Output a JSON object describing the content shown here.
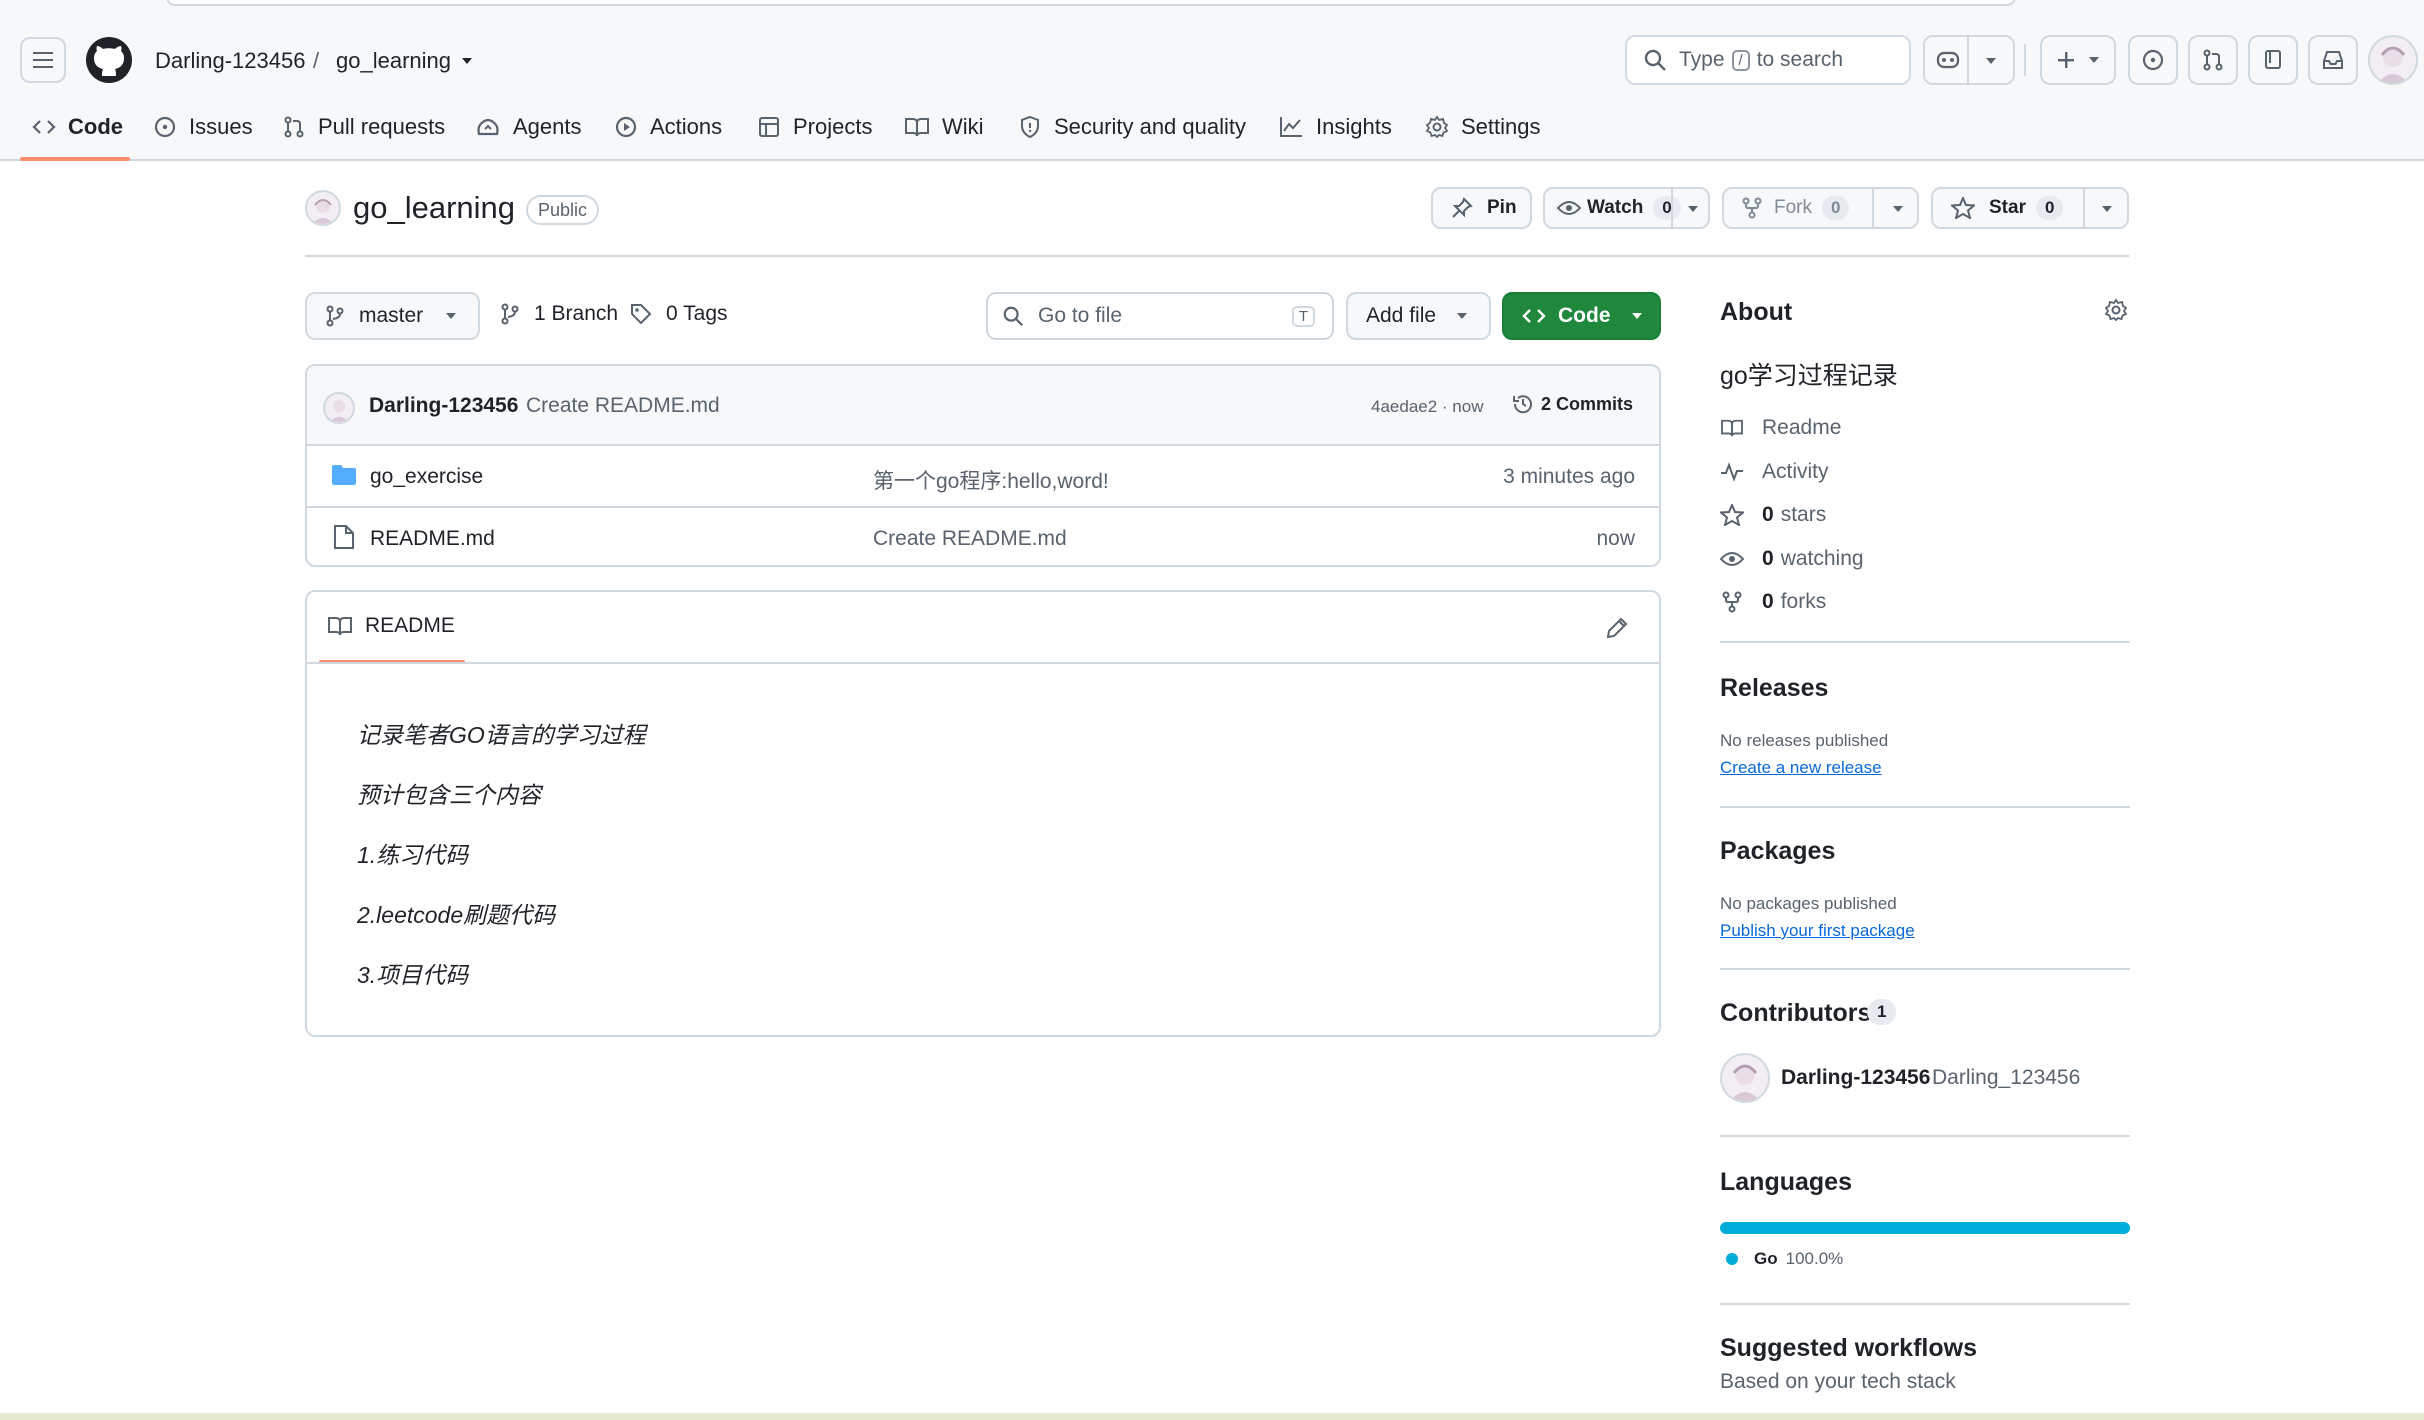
{
  "header": {
    "owner": "Darling-123456",
    "separator": "/",
    "repo": "go_learning",
    "search": {
      "prefix": "Type",
      "key": "/",
      "suffix": "to search"
    }
  },
  "nav": {
    "tabs": [
      {
        "label": "Code",
        "icon": "code-icon"
      },
      {
        "label": "Issues",
        "icon": "issue-opened-icon"
      },
      {
        "label": "Pull requests",
        "icon": "git-pull-request-icon"
      },
      {
        "label": "Agents",
        "icon": "agent-icon"
      },
      {
        "label": "Actions",
        "icon": "play-icon"
      },
      {
        "label": "Projects",
        "icon": "table-icon"
      },
      {
        "label": "Wiki",
        "icon": "book-icon"
      },
      {
        "label": "Security and quality",
        "icon": "shield-icon"
      },
      {
        "label": "Insights",
        "icon": "graph-icon"
      },
      {
        "label": "Settings",
        "icon": "gear-icon"
      }
    ],
    "active": "Code"
  },
  "repo": {
    "name": "go_learning",
    "visibility": "Public",
    "pin_label": "Pin",
    "watch_label": "Watch",
    "watch_count": "0",
    "fork_label": "Fork",
    "fork_count": "0",
    "star_label": "Star",
    "star_count": "0"
  },
  "toolbar": {
    "branch": "master",
    "branches": "1 Branch",
    "tags": "0 Tags",
    "go_to_file_placeholder": "Go to file",
    "go_to_file_key": "T",
    "add_file": "Add file",
    "code": "Code"
  },
  "latest_commit": {
    "author": "Darling-123456",
    "message": "Create README.md",
    "hash_time": "4aedae2 · now",
    "commits": "2 Commits"
  },
  "files": [
    {
      "name": "go_exercise",
      "type": "folder",
      "message": "第一个go程序:hello,word!",
      "time": "3 minutes ago"
    },
    {
      "name": "README.md",
      "type": "file",
      "message": "Create README.md",
      "time": "now"
    }
  ],
  "readme": {
    "tab": "README",
    "lines": [
      "记录笔者GO语言的学习过程",
      "预计包含三个内容",
      "1.练习代码",
      "2.leetcode刷题代码",
      "3.项目代码"
    ]
  },
  "about": {
    "title": "About",
    "description": "go学习过程记录",
    "readme": "Readme",
    "activity": "Activity",
    "stars_count": "0",
    "stars_label": "stars",
    "watching_count": "0",
    "watching_label": "watching",
    "forks_count": "0",
    "forks_label": "forks"
  },
  "releases": {
    "title": "Releases",
    "none": "No releases published",
    "link": "Create a new release"
  },
  "packages": {
    "title": "Packages",
    "none": "No packages published",
    "link": "Publish your first package"
  },
  "contributors": {
    "title": "Contributors",
    "count": "1",
    "login": "Darling-123456",
    "name": "Darling_123456"
  },
  "languages": {
    "title": "Languages",
    "items": [
      {
        "name": "Go",
        "percent": "100.0%",
        "fraction": 1.0,
        "color": "#00add8"
      }
    ]
  },
  "suggested": {
    "title": "Suggested workflows",
    "subtitle": "Based on your tech stack"
  },
  "colors": {
    "accent_green": "#1f883d",
    "link": "#0969da",
    "underline": "#fd8c73"
  }
}
